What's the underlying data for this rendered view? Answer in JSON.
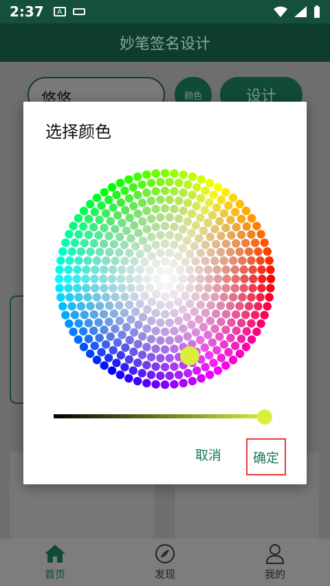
{
  "status_bar": {
    "time": "2:37",
    "icon_a": "A"
  },
  "app_bar": {
    "title": "妙笔签名设计"
  },
  "form": {
    "name_value": "悠悠",
    "color_label": "颜色",
    "design_label": "设计"
  },
  "bottom_nav": {
    "items": [
      {
        "label": "首页",
        "icon": "home-icon"
      },
      {
        "label": "发现",
        "icon": "compass-icon"
      },
      {
        "label": "我的",
        "icon": "person-icon"
      }
    ]
  },
  "dialog": {
    "title": "选择颜色",
    "selected_color": "#d9ef3c",
    "brightness": 0.95,
    "cancel_label": "取消",
    "ok_label": "确定"
  },
  "colors": {
    "accent": "#114a35",
    "action_text": "#127a5c",
    "highlight": "#e23a3a"
  }
}
